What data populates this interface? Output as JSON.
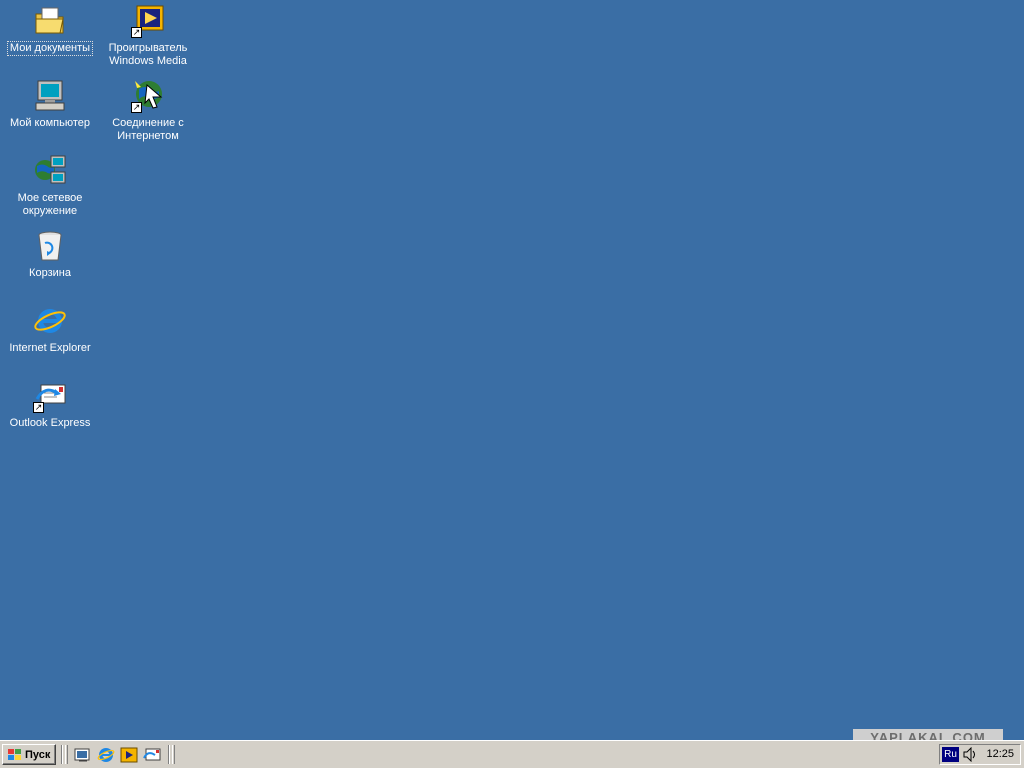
{
  "desktop": {
    "background_color": "#3a6ea5",
    "icons": [
      {
        "label": "Мои документы",
        "icon": "my-documents-icon"
      },
      {
        "label": "Проигрыватель\nWindows Media",
        "icon": "windows-media-player-icon",
        "shortcut": true
      },
      {
        "label": "Мой компьютер",
        "icon": "my-computer-icon"
      },
      {
        "label": "Соединение с\nИнтернетом",
        "icon": "internet-connection-icon",
        "shortcut": true
      },
      {
        "label": "Мое сетевое\nокружение",
        "icon": "network-places-icon"
      },
      {
        "label": "Корзина",
        "icon": "recycle-bin-icon"
      },
      {
        "label": "Internet Explorer",
        "icon": "internet-explorer-icon"
      },
      {
        "label": "Outlook Express",
        "icon": "outlook-express-icon",
        "shortcut": true
      }
    ]
  },
  "watermark": {
    "text": "YAPLAKAL.COM"
  },
  "taskbar": {
    "start_label": "Пуск",
    "quick_launch": [
      {
        "icon": "show-desktop-icon"
      },
      {
        "icon": "internet-explorer-icon"
      },
      {
        "icon": "windows-media-player-icon"
      },
      {
        "icon": "outlook-express-icon"
      }
    ],
    "tray": {
      "language": "Ru",
      "volume_icon": "speaker-icon",
      "clock": "12:25"
    }
  }
}
